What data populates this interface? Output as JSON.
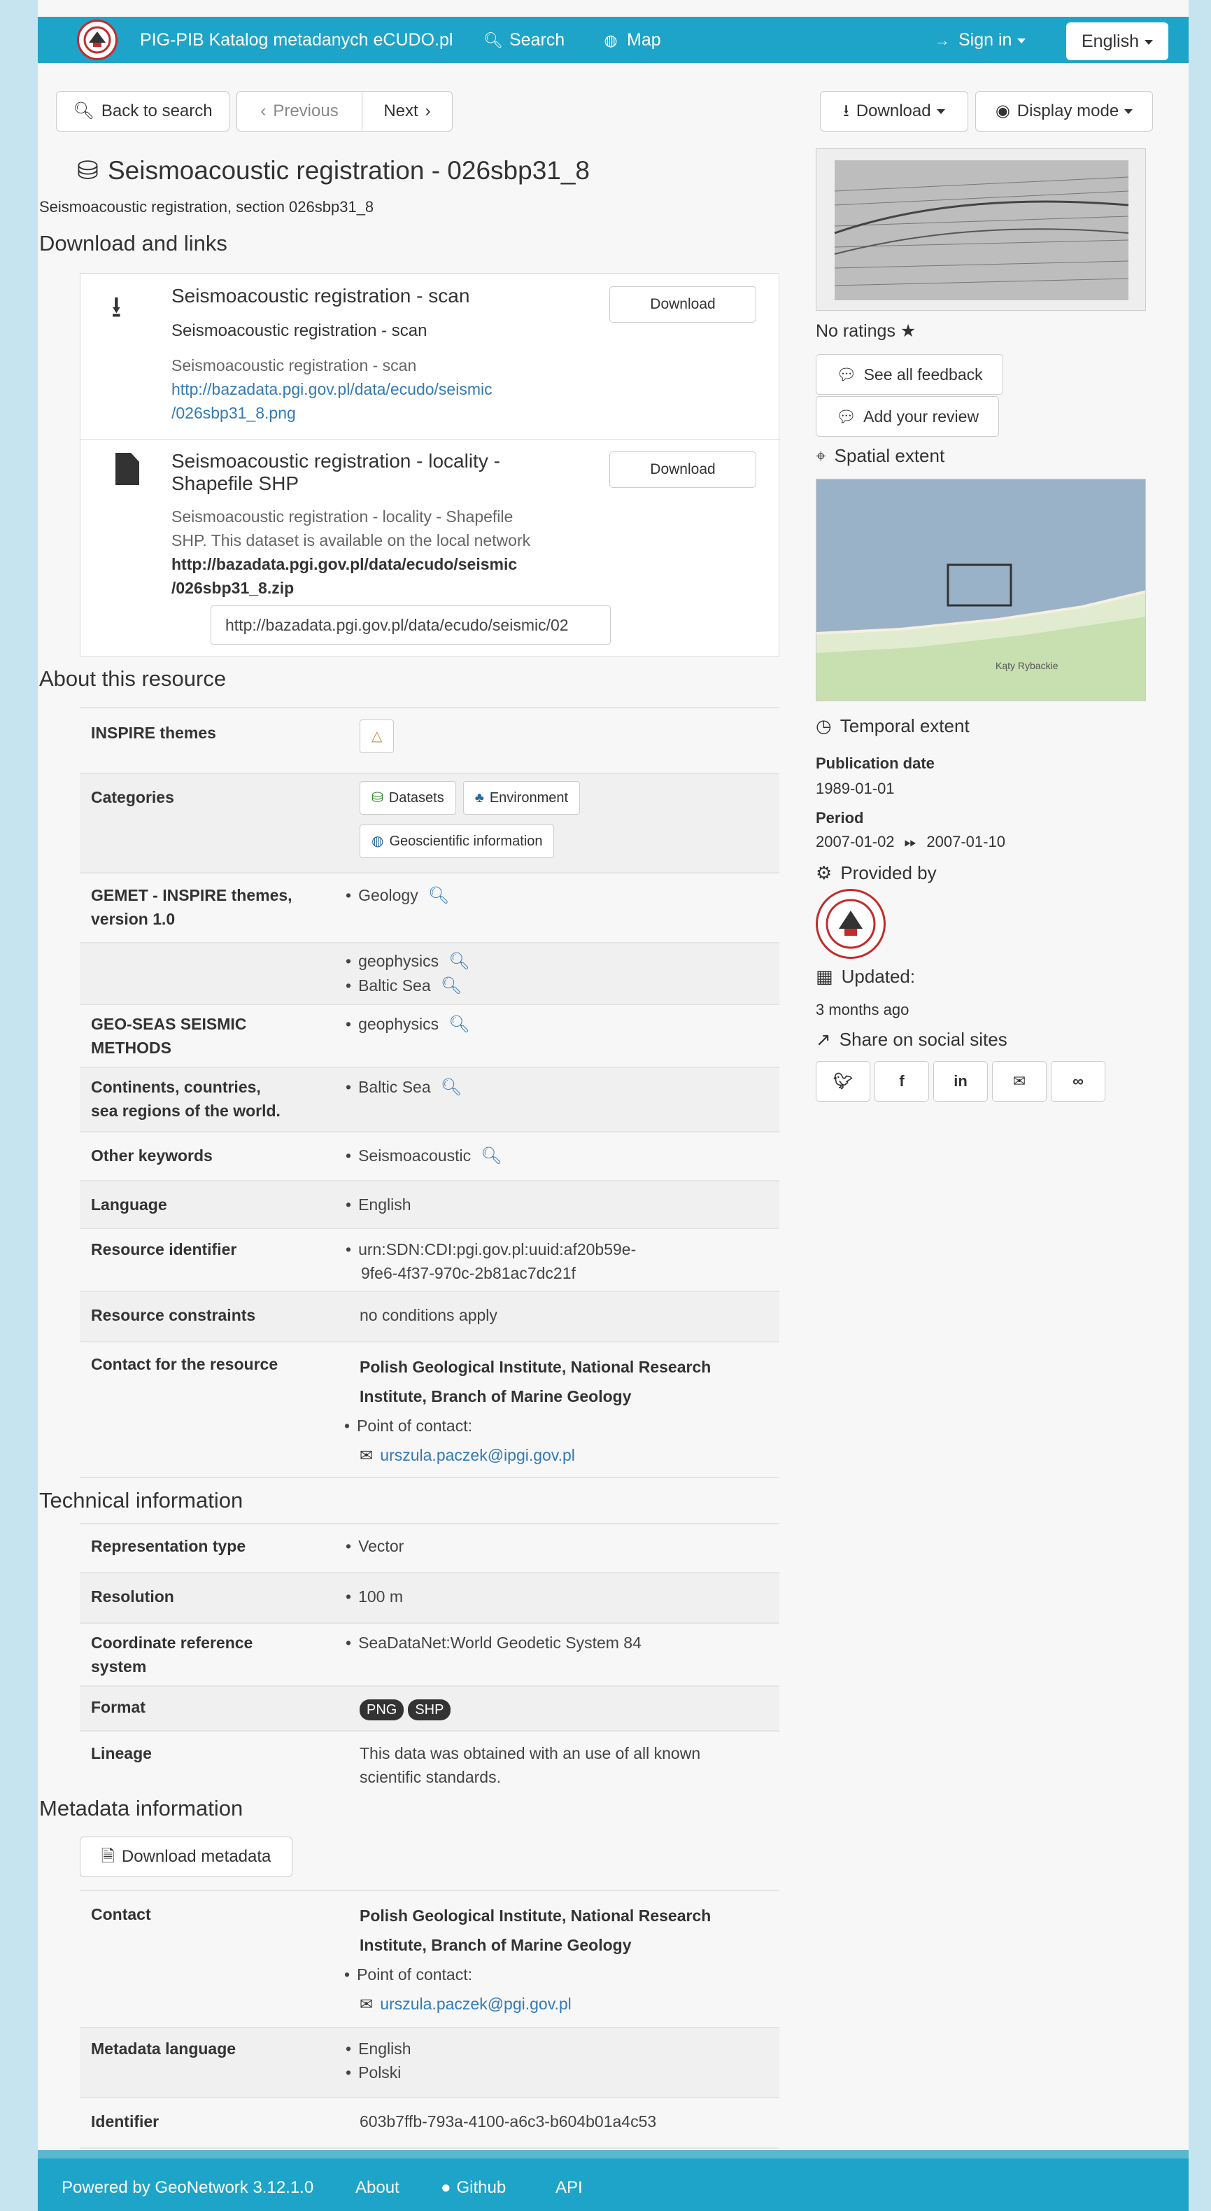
{
  "colors": {
    "navbar": "#1ea4c8",
    "link": "#337ab7",
    "background": "#c6e4f0"
  },
  "nav": {
    "brand": "PIG-PIB Katalog metadanych eCUDO.pl",
    "search": "Search",
    "map": "Map",
    "signin": "Sign in",
    "language": "English"
  },
  "toolbar": {
    "back": "Back to search",
    "previous": "Previous",
    "next": "Next",
    "download": "Download",
    "display_mode": "Display mode"
  },
  "record": {
    "title": "Seismoacoustic registration - 026sbp31_8",
    "subtitle": "Seismoacoustic registration, section 026sbp31_8"
  },
  "links": {
    "heading": "Download and links",
    "items": [
      {
        "title": "Seismoacoustic registration - scan",
        "subtitle": "Seismoacoustic registration - scan",
        "description": "Seismoacoustic registration - scan",
        "url_line1": "http://bazadata.pgi.gov.pl/data/ecudo/seismic",
        "url_line2": "/026sbp31_8.png",
        "button": "Download"
      },
      {
        "title_line1": "Seismoacoustic registration - locality -",
        "title_line2": "Shapefile SHP",
        "description_line1": "Seismoacoustic registration - locality - Shapefile",
        "description_line2": "SHP. This dataset is available on the local network",
        "url_line1": "http://bazadata.pgi.gov.pl/data/ecudo/seismic",
        "url_line2": "/026sbp31_8.zip",
        "input_value": "http://bazadata.pgi.gov.pl/data/ecudo/seismic/02",
        "button": "Download"
      }
    ]
  },
  "about": {
    "heading": "About this resource",
    "inspire_themes": "INSPIRE themes",
    "categories": "Categories",
    "category_chips": [
      "Datasets",
      "Environment",
      "Geoscientific information"
    ],
    "gemet_key_line1": "GEMET - INSPIRE themes,",
    "gemet_key_line2": "version 1.0",
    "gemet_values": [
      "Geology"
    ],
    "unnamed_values": [
      "geophysics",
      "Baltic Sea"
    ],
    "geoseas_key_line1": "GEO-SEAS SEISMIC",
    "geoseas_key_line2": "METHODS",
    "geoseas_values": [
      "geophysics"
    ],
    "continents_key_line1": "Continents, countries,",
    "continents_key_line2": "sea regions of the world.",
    "continents_values": [
      "Baltic Sea"
    ],
    "other_keywords": "Other keywords",
    "other_values": [
      "Seismoacoustic"
    ],
    "language": "Language",
    "language_values": [
      "English"
    ],
    "resource_identifier": "Resource identifier",
    "resource_identifier_line1": "urn:SDN:CDI:pgi.gov.pl:uuid:af20b59e-",
    "resource_identifier_line2": "9fe6-4f37-970c-2b81ac7dc21f",
    "resource_constraints": "Resource constraints",
    "constraints_value": "no conditions apply",
    "contact": "Contact for the resource",
    "org_line1": "Polish Geological Institute, National Research",
    "org_line2": "Institute, Branch of Marine Geology",
    "poc": "Point of contact:",
    "email": "urszula.paczek@ipgi.gov.pl"
  },
  "technical": {
    "heading": "Technical information",
    "representation_type": "Representation type",
    "representation_value": "Vector",
    "resolution": "Resolution",
    "resolution_value": "100 m",
    "crs_line1": "Coordinate reference",
    "crs_line2": "system",
    "crs_value": "SeaDataNet:World Geodetic System 84",
    "format": "Format",
    "formats": [
      "PNG",
      "SHP"
    ],
    "lineage": "Lineage",
    "lineage_line1": "This data was obtained with an use of all known",
    "lineage_line2": "scientific standards."
  },
  "metadata": {
    "heading": "Metadata information",
    "download_metadata": "Download metadata",
    "contact": "Contact",
    "org_line1": "Polish Geological Institute, National Research",
    "org_line2": "Institute, Branch of Marine Geology",
    "poc": "Point of contact:",
    "email": "urszula.paczek@pgi.gov.pl",
    "metadata_language": "Metadata language",
    "languages": [
      "English",
      "Polski"
    ],
    "identifier": "Identifier",
    "identifier_value": "603b7ffb-793a-4100-a6c3-b604b01a4c53"
  },
  "sidebar": {
    "ratings": "No ratings",
    "see_feedback": "See all feedback",
    "add_review": "Add your review",
    "spatial_extent": "Spatial extent",
    "map_label": "Kąty Rybackie",
    "temporal_extent": "Temporal extent",
    "publication_date_label": "Publication date",
    "publication_date": "1989-01-01",
    "period_label": "Period",
    "period_start": "2007-01-02",
    "period_end": "2007-01-10",
    "provided_by": "Provided by",
    "updated_label": "Updated:",
    "updated_value": "3 months ago",
    "share": "Share on social sites"
  },
  "footer": {
    "powered": "Powered by GeoNetwork 3.12.1.0",
    "about": "About",
    "github": "Github",
    "api": "API"
  }
}
